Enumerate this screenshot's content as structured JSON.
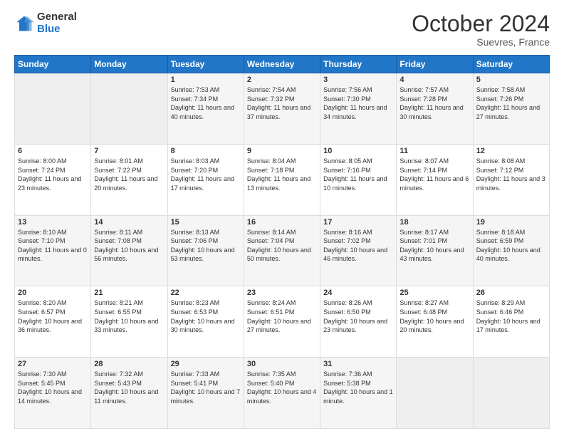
{
  "header": {
    "logo_general": "General",
    "logo_blue": "Blue",
    "month_title": "October 2024",
    "location": "Suevres, France"
  },
  "weekdays": [
    "Sunday",
    "Monday",
    "Tuesday",
    "Wednesday",
    "Thursday",
    "Friday",
    "Saturday"
  ],
  "weeks": [
    [
      {
        "day": "",
        "sunrise": "",
        "sunset": "",
        "daylight": ""
      },
      {
        "day": "",
        "sunrise": "",
        "sunset": "",
        "daylight": ""
      },
      {
        "day": "1",
        "sunrise": "Sunrise: 7:53 AM",
        "sunset": "Sunset: 7:34 PM",
        "daylight": "Daylight: 11 hours and 40 minutes."
      },
      {
        "day": "2",
        "sunrise": "Sunrise: 7:54 AM",
        "sunset": "Sunset: 7:32 PM",
        "daylight": "Daylight: 11 hours and 37 minutes."
      },
      {
        "day": "3",
        "sunrise": "Sunrise: 7:56 AM",
        "sunset": "Sunset: 7:30 PM",
        "daylight": "Daylight: 11 hours and 34 minutes."
      },
      {
        "day": "4",
        "sunrise": "Sunrise: 7:57 AM",
        "sunset": "Sunset: 7:28 PM",
        "daylight": "Daylight: 11 hours and 30 minutes."
      },
      {
        "day": "5",
        "sunrise": "Sunrise: 7:58 AM",
        "sunset": "Sunset: 7:26 PM",
        "daylight": "Daylight: 11 hours and 27 minutes."
      }
    ],
    [
      {
        "day": "6",
        "sunrise": "Sunrise: 8:00 AM",
        "sunset": "Sunset: 7:24 PM",
        "daylight": "Daylight: 11 hours and 23 minutes."
      },
      {
        "day": "7",
        "sunrise": "Sunrise: 8:01 AM",
        "sunset": "Sunset: 7:22 PM",
        "daylight": "Daylight: 11 hours and 20 minutes."
      },
      {
        "day": "8",
        "sunrise": "Sunrise: 8:03 AM",
        "sunset": "Sunset: 7:20 PM",
        "daylight": "Daylight: 11 hours and 17 minutes."
      },
      {
        "day": "9",
        "sunrise": "Sunrise: 8:04 AM",
        "sunset": "Sunset: 7:18 PM",
        "daylight": "Daylight: 11 hours and 13 minutes."
      },
      {
        "day": "10",
        "sunrise": "Sunrise: 8:05 AM",
        "sunset": "Sunset: 7:16 PM",
        "daylight": "Daylight: 11 hours and 10 minutes."
      },
      {
        "day": "11",
        "sunrise": "Sunrise: 8:07 AM",
        "sunset": "Sunset: 7:14 PM",
        "daylight": "Daylight: 11 hours and 6 minutes."
      },
      {
        "day": "12",
        "sunrise": "Sunrise: 8:08 AM",
        "sunset": "Sunset: 7:12 PM",
        "daylight": "Daylight: 11 hours and 3 minutes."
      }
    ],
    [
      {
        "day": "13",
        "sunrise": "Sunrise: 8:10 AM",
        "sunset": "Sunset: 7:10 PM",
        "daylight": "Daylight: 11 hours and 0 minutes."
      },
      {
        "day": "14",
        "sunrise": "Sunrise: 8:11 AM",
        "sunset": "Sunset: 7:08 PM",
        "daylight": "Daylight: 10 hours and 56 minutes."
      },
      {
        "day": "15",
        "sunrise": "Sunrise: 8:13 AM",
        "sunset": "Sunset: 7:06 PM",
        "daylight": "Daylight: 10 hours and 53 minutes."
      },
      {
        "day": "16",
        "sunrise": "Sunrise: 8:14 AM",
        "sunset": "Sunset: 7:04 PM",
        "daylight": "Daylight: 10 hours and 50 minutes."
      },
      {
        "day": "17",
        "sunrise": "Sunrise: 8:16 AM",
        "sunset": "Sunset: 7:02 PM",
        "daylight": "Daylight: 10 hours and 46 minutes."
      },
      {
        "day": "18",
        "sunrise": "Sunrise: 8:17 AM",
        "sunset": "Sunset: 7:01 PM",
        "daylight": "Daylight: 10 hours and 43 minutes."
      },
      {
        "day": "19",
        "sunrise": "Sunrise: 8:18 AM",
        "sunset": "Sunset: 6:59 PM",
        "daylight": "Daylight: 10 hours and 40 minutes."
      }
    ],
    [
      {
        "day": "20",
        "sunrise": "Sunrise: 8:20 AM",
        "sunset": "Sunset: 6:57 PM",
        "daylight": "Daylight: 10 hours and 36 minutes."
      },
      {
        "day": "21",
        "sunrise": "Sunrise: 8:21 AM",
        "sunset": "Sunset: 6:55 PM",
        "daylight": "Daylight: 10 hours and 33 minutes."
      },
      {
        "day": "22",
        "sunrise": "Sunrise: 8:23 AM",
        "sunset": "Sunset: 6:53 PM",
        "daylight": "Daylight: 10 hours and 30 minutes."
      },
      {
        "day": "23",
        "sunrise": "Sunrise: 8:24 AM",
        "sunset": "Sunset: 6:51 PM",
        "daylight": "Daylight: 10 hours and 27 minutes."
      },
      {
        "day": "24",
        "sunrise": "Sunrise: 8:26 AM",
        "sunset": "Sunset: 6:50 PM",
        "daylight": "Daylight: 10 hours and 23 minutes."
      },
      {
        "day": "25",
        "sunrise": "Sunrise: 8:27 AM",
        "sunset": "Sunset: 6:48 PM",
        "daylight": "Daylight: 10 hours and 20 minutes."
      },
      {
        "day": "26",
        "sunrise": "Sunrise: 8:29 AM",
        "sunset": "Sunset: 6:46 PM",
        "daylight": "Daylight: 10 hours and 17 minutes."
      }
    ],
    [
      {
        "day": "27",
        "sunrise": "Sunrise: 7:30 AM",
        "sunset": "Sunset: 5:45 PM",
        "daylight": "Daylight: 10 hours and 14 minutes."
      },
      {
        "day": "28",
        "sunrise": "Sunrise: 7:32 AM",
        "sunset": "Sunset: 5:43 PM",
        "daylight": "Daylight: 10 hours and 11 minutes."
      },
      {
        "day": "29",
        "sunrise": "Sunrise: 7:33 AM",
        "sunset": "Sunset: 5:41 PM",
        "daylight": "Daylight: 10 hours and 7 minutes."
      },
      {
        "day": "30",
        "sunrise": "Sunrise: 7:35 AM",
        "sunset": "Sunset: 5:40 PM",
        "daylight": "Daylight: 10 hours and 4 minutes."
      },
      {
        "day": "31",
        "sunrise": "Sunrise: 7:36 AM",
        "sunset": "Sunset: 5:38 PM",
        "daylight": "Daylight: 10 hours and 1 minute."
      },
      {
        "day": "",
        "sunrise": "",
        "sunset": "",
        "daylight": ""
      },
      {
        "day": "",
        "sunrise": "",
        "sunset": "",
        "daylight": ""
      }
    ]
  ]
}
